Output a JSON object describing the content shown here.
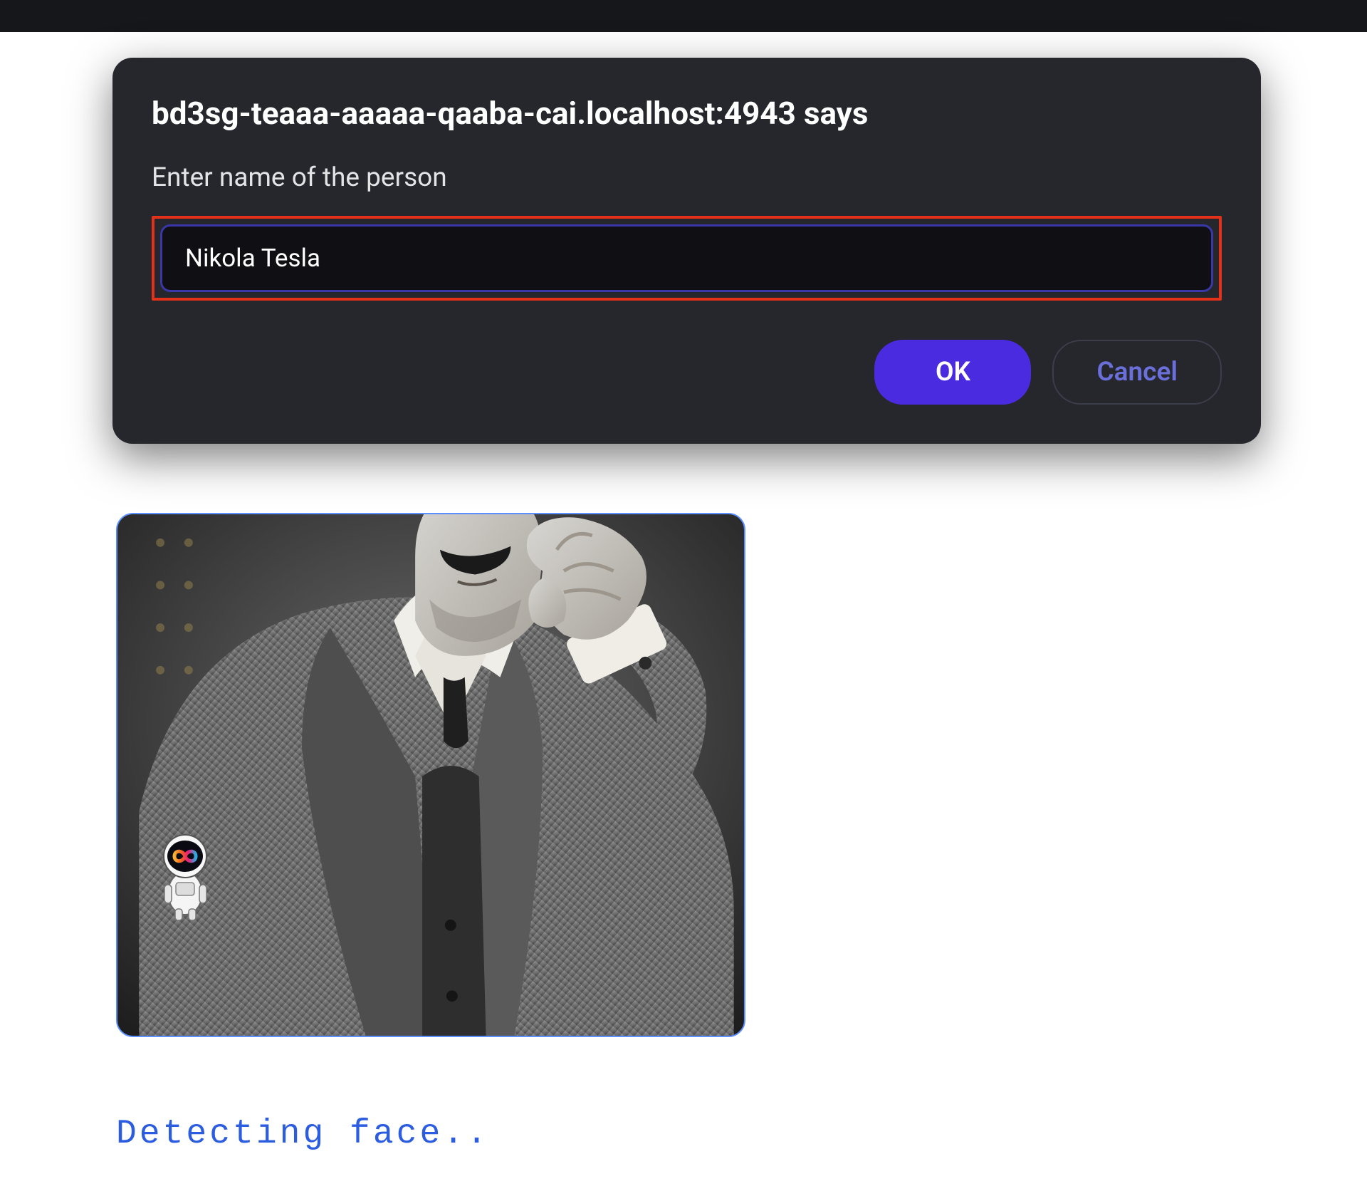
{
  "dialog": {
    "title": "bd3sg-teaaa-aaaaa-qaaba-cai.localhost:4943 says",
    "prompt": "Enter name of the person",
    "input_value": "Nikola Tesla",
    "ok_label": "OK",
    "cancel_label": "Cancel"
  },
  "page": {
    "status_text": "Detecting face.."
  },
  "colors": {
    "dialog_bg": "#25272c",
    "accent": "#4b2be0",
    "highlight_border": "#e3311a",
    "status_color": "#2c5ce0",
    "image_border": "#5b8eff"
  }
}
